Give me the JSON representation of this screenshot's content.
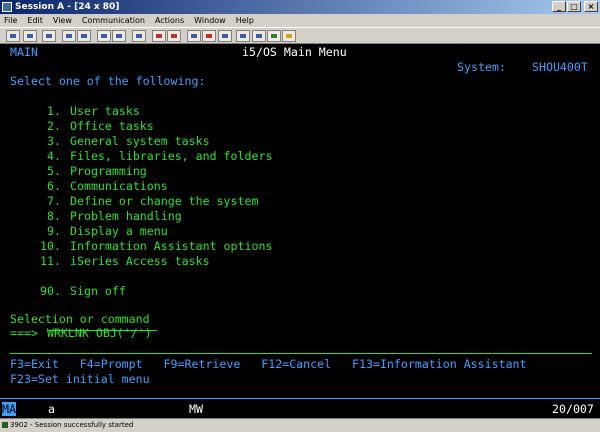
{
  "window": {
    "title": "Session A - [24 x 80]",
    "controls": {
      "minimize": "_",
      "restore": "□",
      "close": "×"
    }
  },
  "menubar": [
    "File",
    "Edit",
    "View",
    "Communication",
    "Actions",
    "Window",
    "Help"
  ],
  "toolbar": {
    "buttons": [
      "print-screen",
      "copy",
      "paste",
      "send",
      "receive",
      "display",
      "record",
      "stop",
      "play",
      "clipboard",
      "keypad",
      "macro",
      "map",
      "help",
      "key",
      "globe",
      "settings"
    ],
    "colors": {
      "primary": "#3a5ea8",
      "red": "#c03030",
      "green": "#308030",
      "yellow": "#d0a020"
    }
  },
  "screen": {
    "menu_id": "MAIN",
    "title": "i5/OS Main Menu",
    "system_label": "System:",
    "system_name": "SHOU400T",
    "instruction": "Select one of the following:",
    "options": [
      {
        "num": "1.",
        "label": "User tasks"
      },
      {
        "num": "2.",
        "label": "Office tasks"
      },
      {
        "num": "3.",
        "label": "General system tasks"
      },
      {
        "num": "4.",
        "label": "Files, libraries, and folders"
      },
      {
        "num": "5.",
        "label": "Programming"
      },
      {
        "num": "6.",
        "label": "Communications"
      },
      {
        "num": "7.",
        "label": "Define or change the system"
      },
      {
        "num": "8.",
        "label": "Problem handling"
      },
      {
        "num": "9.",
        "label": "Display a menu"
      },
      {
        "num": "10.",
        "label": "Information Assistant options"
      },
      {
        "num": "11.",
        "label": "iSeries Access tasks"
      }
    ],
    "signoff": {
      "num": "90.",
      "label": "Sign off"
    },
    "selection_prompt": "Selection or command",
    "command_arrow": "===>",
    "command_value": "WRKLNK OBJ('/')",
    "fkeys_row1": "F3=Exit   F4=Prompt   F9=Retrieve   F12=Cancel   F13=Information Assistant",
    "fkeys_row2": "F23=Set initial menu"
  },
  "oia": {
    "left": "MA",
    "mode": "a",
    "mw": "MW",
    "position": "20/007"
  },
  "statusbar": {
    "message": "3902 - Session successfully started"
  },
  "colors": {
    "background": "#000000",
    "field_blue": "#40a0ff",
    "text_green": "#29e329",
    "text_white": "#ffffff"
  }
}
